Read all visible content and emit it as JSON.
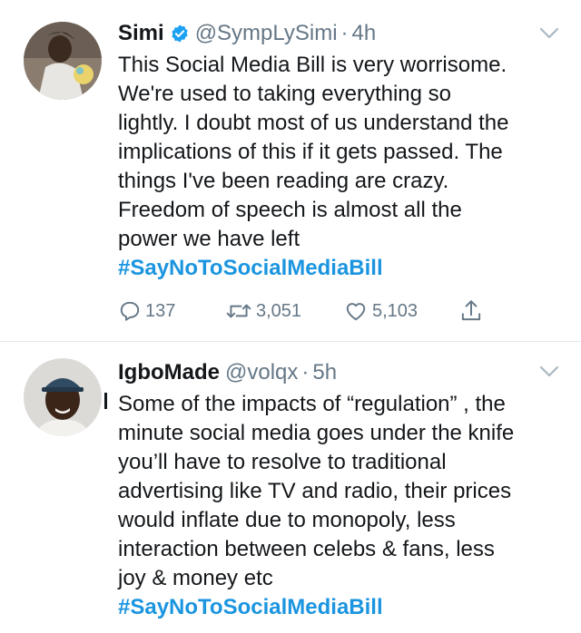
{
  "tweets": [
    {
      "name": "Simi",
      "handle": "@SympLySimi",
      "separator": "·",
      "time": "4h",
      "verified": true,
      "lines": [
        "This Social Media Bill is very worrisome.",
        "We're used to taking everything so",
        "lightly. I doubt most of us understand the",
        "implications of this if it gets passed. The",
        "things I've been reading are crazy.",
        "Freedom of speech is almost all the",
        "power we have left"
      ],
      "hashtag": "#SayNoToSocialMediaBill",
      "replies": "137",
      "retweets": "3,051",
      "likes": "5,103"
    },
    {
      "name": "IgboMade",
      "handle": "@volqx",
      "separator": "·",
      "time": "5h",
      "verified": false,
      "lines": [
        "Some of the impacts of “regulation” , the",
        "minute social media goes under the knife",
        "you’ll have to resolve to traditional",
        "advertising like TV and radio, their prices",
        "would inflate due to monopoly, less",
        "interaction between celebs & fans, less",
        "joy & money etc"
      ],
      "hashtag": "#SayNoToSocialMediaBill"
    }
  ],
  "icons": {
    "reply": "reply-icon",
    "retweet": "retweet-icon",
    "like": "heart-icon",
    "share": "share-icon",
    "verified": "verified-badge-icon",
    "more": "chevron-down-icon"
  },
  "colors": {
    "hashtag": "#1b95e0",
    "muted": "#657786",
    "verified": "#1da1f2",
    "text": "#14171a"
  }
}
